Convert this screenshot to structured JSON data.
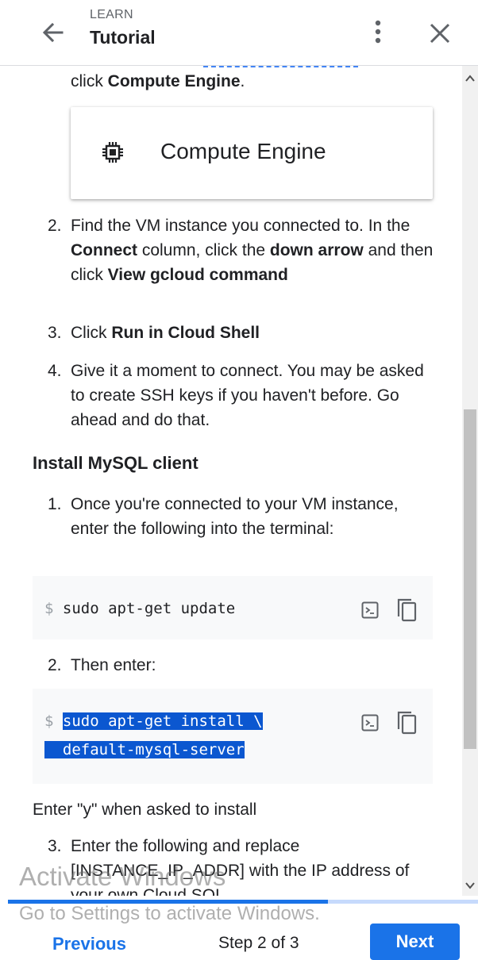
{
  "header": {
    "overline": "LEARN",
    "title": "Tutorial"
  },
  "content": {
    "intro": {
      "prefix": "click ",
      "bold": "Compute Engine",
      "suffix": "."
    },
    "card_label": "Compute Engine",
    "steps_a": [
      {
        "num": "2.",
        "parts": [
          "Find the VM instance you connected to. In the ",
          "Connect",
          " column, click the ",
          "down arrow",
          " and then click ",
          "View gcloud command"
        ]
      },
      {
        "num": "3.",
        "parts": [
          "Click ",
          "Run in Cloud Shell"
        ]
      },
      {
        "num": "4.",
        "parts": [
          "Give it a moment to connect. You may be asked to create SSH keys if you haven't before. Go ahead and do that."
        ]
      }
    ],
    "section_title": "Install MySQL client",
    "step_b1": {
      "num": "1.",
      "text": "Once you're connected to your VM instance, enter the following into the terminal:"
    },
    "code1": {
      "prompt": "$",
      "command": "sudo apt-get update"
    },
    "step_b2": {
      "num": "2.",
      "text": "Then enter:"
    },
    "code2": {
      "prompt": "$",
      "line1": "sudo apt-get install \\",
      "line2": "  default-mysql-server"
    },
    "note": "Enter \"y\" when asked to install",
    "step_b3": {
      "num": "3.",
      "text": "Enter the following and replace [INSTANCE_IP_ADDR] with the IP address of your own Cloud SQL"
    }
  },
  "watermark": {
    "line1": "Activate Windows",
    "line2": "Go to Settings to activate Windows."
  },
  "progress": {
    "fraction": 0.68
  },
  "footer": {
    "previous": "Previous",
    "step": "Step 2 of 3",
    "next": "Next"
  },
  "colors": {
    "accent": "#1a73e8",
    "selection": "#0b57d0"
  }
}
